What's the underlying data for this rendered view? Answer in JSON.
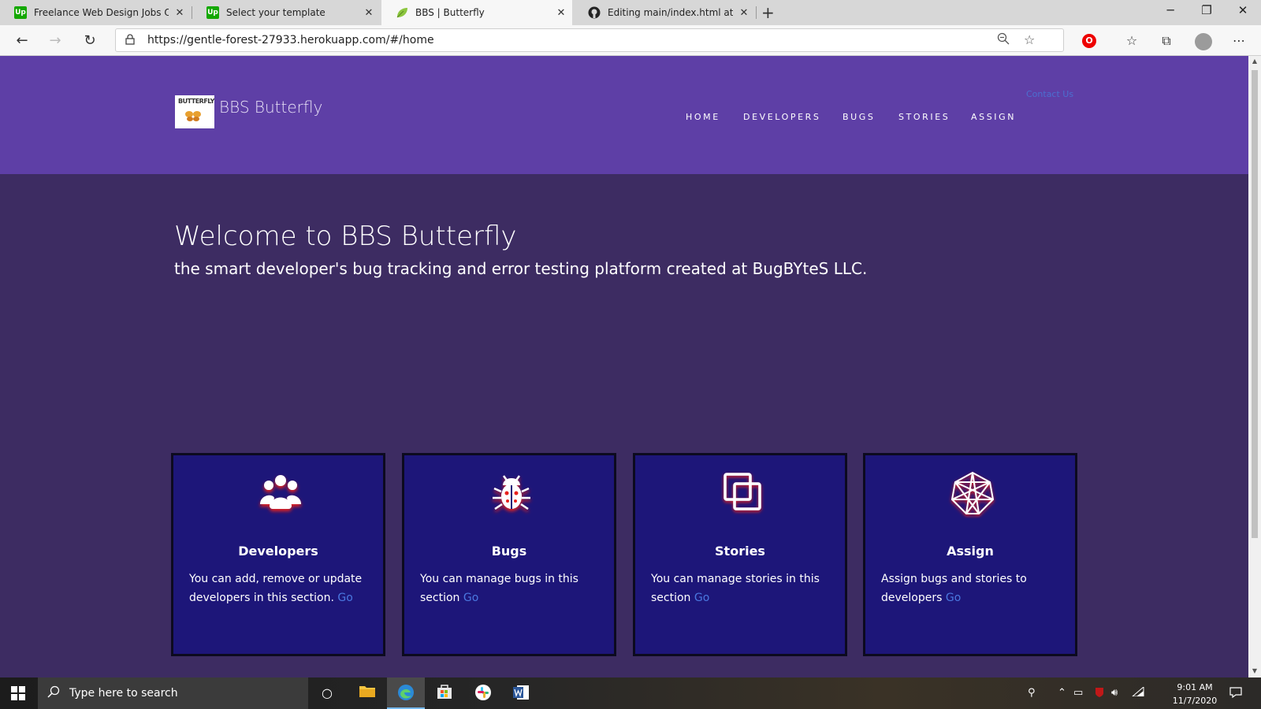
{
  "browser": {
    "tabs": [
      {
        "label": "Freelance Web Design Jobs Onlin",
        "favicon": "upwork-icon",
        "active": false
      },
      {
        "label": "Select your template",
        "favicon": "upwork-icon",
        "active": false
      },
      {
        "label": "BBS | Butterfly",
        "favicon": "leaf-icon",
        "active": true
      },
      {
        "label": "Editing main/index.html at maste",
        "favicon": "github-icon",
        "active": false
      }
    ],
    "favicon_text": "Up",
    "url": "https://gentle-forest-27933.herokuapp.com/#/home"
  },
  "site": {
    "logo_text": "BUTTERFLY",
    "brand": "BBS Butterfly",
    "contact": "Contact Us",
    "nav": [
      "HOME",
      "DEVELOPERS",
      "BUGS",
      "STORIES",
      "ASSIGN"
    ],
    "hero_title": "Welcome to BBS Butterfly",
    "hero_subtitle": "the smart developer's bug tracking and error testing platform created at BugBYteS LLC.",
    "cards": [
      {
        "title": "Developers",
        "text": "You can add, remove or update developers in this section.",
        "link": "Go",
        "icon": "users-icon"
      },
      {
        "title": "Bugs",
        "text": "You can manage bugs in this section",
        "link": "Go",
        "icon": "bug-icon"
      },
      {
        "title": "Stories",
        "text": "You can manage stories in this section",
        "link": "Go",
        "icon": "stories-icon"
      },
      {
        "title": "Assign",
        "text": "Assign bugs and stories to developers",
        "link": "Go",
        "icon": "network-icon"
      }
    ]
  },
  "taskbar": {
    "search_placeholder": "Type here to search",
    "time": "9:01 AM",
    "date": "11/7/2020"
  },
  "colors": {
    "header": "#5e3fa6",
    "page_bg": "#3d2c62",
    "card_bg": "#1d1679",
    "link": "#4a78e0",
    "icon_glow": "#e8201f"
  }
}
